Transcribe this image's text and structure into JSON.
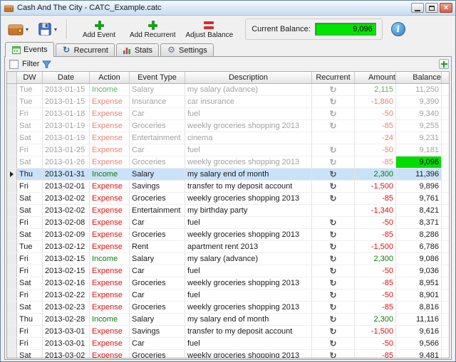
{
  "window": {
    "title": "Cash And The City - CATC_Example.catc"
  },
  "toolbar": {
    "add_event": "Add Event",
    "add_recurrent": "Add Recurrent",
    "adjust_balance": "Adjust Balance",
    "current_balance_label": "Current Balance:",
    "current_balance_value": "9,096"
  },
  "tabs": [
    {
      "label": "Events",
      "active": true
    },
    {
      "label": "Recurrent",
      "active": false
    },
    {
      "label": "Stats",
      "active": false
    },
    {
      "label": "Settings",
      "active": false
    }
  ],
  "filter": {
    "label": "Filter",
    "checked": false
  },
  "icons": [
    "wallet-icon",
    "save-icon",
    "plus-icon",
    "equals-icon",
    "info-icon",
    "filter-funnel-icon",
    "recurrent-icon",
    "calendar-icon",
    "bar-chart-icon",
    "gear-icon"
  ],
  "colors": {
    "balance_highlight": "#00e400",
    "selection": "#c9e2f8",
    "income": "#0a7d0a",
    "expense": "#e01010",
    "past_text": "#a2a2a2"
  },
  "table": {
    "columns": [
      "DW",
      "Date",
      "Action",
      "Event Type",
      "Description",
      "Recurrent",
      "Amount",
      "Balance"
    ],
    "rows": [
      {
        "dw": "Tue",
        "date": "2013-01-15",
        "action": "Income",
        "event_type": "Salary",
        "description": "my salary (advance)",
        "recurrent": true,
        "amount": "2,115",
        "balance": "11,250",
        "past": true
      },
      {
        "dw": "Tue",
        "date": "2013-01-15",
        "action": "Expense",
        "event_type": "Insurance",
        "description": "car insurance",
        "recurrent": true,
        "amount": "-1,860",
        "balance": "9,390",
        "past": true
      },
      {
        "dw": "Fri",
        "date": "2013-01-18",
        "action": "Expense",
        "event_type": "Car",
        "description": "fuel",
        "recurrent": true,
        "amount": "-50",
        "balance": "9,340",
        "past": true
      },
      {
        "dw": "Sat",
        "date": "2013-01-19",
        "action": "Expense",
        "event_type": "Groceries",
        "description": "weekly groceries shopping 2013",
        "recurrent": true,
        "amount": "-85",
        "balance": "9,255",
        "past": true
      },
      {
        "dw": "Sat",
        "date": "2013-01-19",
        "action": "Expense",
        "event_type": "Entertainment",
        "description": "cinema",
        "recurrent": false,
        "amount": "-24",
        "balance": "9,231",
        "past": true
      },
      {
        "dw": "Fri",
        "date": "2013-01-25",
        "action": "Expense",
        "event_type": "Car",
        "description": "fuel",
        "recurrent": true,
        "amount": "-50",
        "balance": "9,181",
        "past": true
      },
      {
        "dw": "Sat",
        "date": "2013-01-26",
        "action": "Expense",
        "event_type": "Groceries",
        "description": "weekly groceries shopping 2013",
        "recurrent": true,
        "amount": "-85",
        "balance": "9,096",
        "past": true,
        "balance_highlight": true
      },
      {
        "dw": "Thu",
        "date": "2013-01-31",
        "action": "Income",
        "event_type": "Salary",
        "description": "my salary end of month",
        "recurrent": true,
        "amount": "2,300",
        "balance": "11,396",
        "selected": true
      },
      {
        "dw": "Fri",
        "date": "2013-02-01",
        "action": "Expense",
        "event_type": "Savings",
        "description": "transfer to my deposit account",
        "recurrent": true,
        "amount": "-1,500",
        "balance": "9,896"
      },
      {
        "dw": "Sat",
        "date": "2013-02-02",
        "action": "Expense",
        "event_type": "Groceries",
        "description": "weekly groceries shopping 2013",
        "recurrent": true,
        "amount": "-85",
        "balance": "9,761"
      },
      {
        "dw": "Sat",
        "date": "2013-02-02",
        "action": "Expense",
        "event_type": "Entertainment",
        "description": "my birthday party",
        "recurrent": false,
        "amount": "-1,340",
        "balance": "8,421"
      },
      {
        "dw": "Fri",
        "date": "2013-02-08",
        "action": "Expense",
        "event_type": "Car",
        "description": "fuel",
        "recurrent": true,
        "amount": "-50",
        "balance": "8,371"
      },
      {
        "dw": "Sat",
        "date": "2013-02-09",
        "action": "Expense",
        "event_type": "Groceries",
        "description": "weekly groceries shopping 2013",
        "recurrent": true,
        "amount": "-85",
        "balance": "8,286"
      },
      {
        "dw": "Tue",
        "date": "2013-02-12",
        "action": "Expense",
        "event_type": "Rent",
        "description": "apartment rent 2013",
        "recurrent": true,
        "amount": "-1,500",
        "balance": "6,786"
      },
      {
        "dw": "Fri",
        "date": "2013-02-15",
        "action": "Income",
        "event_type": "Salary",
        "description": "my salary (advance)",
        "recurrent": true,
        "amount": "2,300",
        "balance": "9,086"
      },
      {
        "dw": "Fri",
        "date": "2013-02-15",
        "action": "Expense",
        "event_type": "Car",
        "description": "fuel",
        "recurrent": true,
        "amount": "-50",
        "balance": "9,036"
      },
      {
        "dw": "Sat",
        "date": "2013-02-16",
        "action": "Expense",
        "event_type": "Groceries",
        "description": "weekly groceries shopping 2013",
        "recurrent": true,
        "amount": "-85",
        "balance": "8,951"
      },
      {
        "dw": "Fri",
        "date": "2013-02-22",
        "action": "Expense",
        "event_type": "Car",
        "description": "fuel",
        "recurrent": true,
        "amount": "-50",
        "balance": "8,901"
      },
      {
        "dw": "Sat",
        "date": "2013-02-23",
        "action": "Expense",
        "event_type": "Groceries",
        "description": "weekly groceries shopping 2013",
        "recurrent": true,
        "amount": "-85",
        "balance": "8,816"
      },
      {
        "dw": "Thu",
        "date": "2013-02-28",
        "action": "Income",
        "event_type": "Salary",
        "description": "my salary end of month",
        "recurrent": true,
        "amount": "2,300",
        "balance": "11,116"
      },
      {
        "dw": "Fri",
        "date": "2013-03-01",
        "action": "Expense",
        "event_type": "Savings",
        "description": "transfer to my deposit account",
        "recurrent": true,
        "amount": "-1,500",
        "balance": "9,616"
      },
      {
        "dw": "Fri",
        "date": "2013-03-01",
        "action": "Expense",
        "event_type": "Car",
        "description": "fuel",
        "recurrent": true,
        "amount": "-50",
        "balance": "9,566"
      },
      {
        "dw": "Sat",
        "date": "2013-03-02",
        "action": "Expense",
        "event_type": "Groceries",
        "description": "weekly groceries shopping 2013",
        "recurrent": true,
        "amount": "-85",
        "balance": "9,481"
      }
    ]
  }
}
